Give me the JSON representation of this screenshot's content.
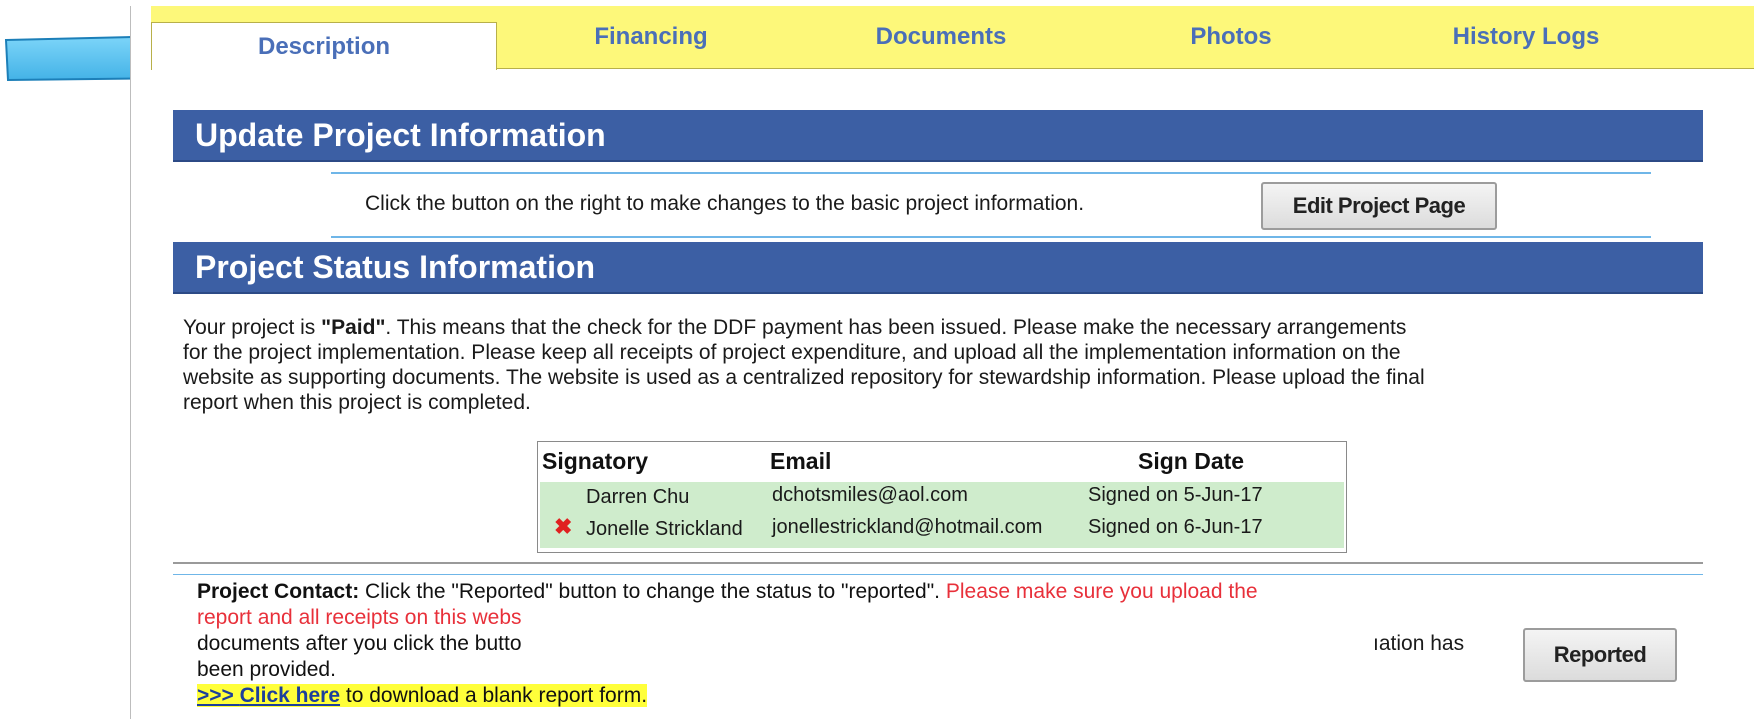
{
  "tabs": [
    "Description",
    "Financing",
    "Documents",
    "Photos",
    "History Logs"
  ],
  "active_tab": "Description",
  "update_section": {
    "title": "Update Project Information",
    "instruction": "Click the button on the right to make changes to the basic project information.",
    "button_label": "Edit Project Page"
  },
  "status_section": {
    "title": "Project Status Information",
    "lines": [
      {
        "prefix": "Your project is ",
        "bold": "\"Paid\"",
        "rest": ".  This means that the check for the DDF payment has been issued. Please make the necessary arrangements"
      },
      {
        "text": "for the project implementation. Please keep all receipts of project expenditure, and upload all the implementation information on the"
      },
      {
        "text": "website as supporting documents. The website is used as a centralized repository for stewardship information. Please upload the final"
      },
      {
        "text": "report when this project is completed."
      }
    ]
  },
  "signatories": {
    "headers": {
      "signatory": "Signatory",
      "email": "Email",
      "sign_date": "Sign Date"
    },
    "rows": [
      {
        "name": "Darren Chu",
        "email": "dchotsmiles@aol.com",
        "date": "Signed on 5-Jun-17",
        "icon": "none"
      },
      {
        "name": "Jonelle Strickland",
        "email": "jonellestrickland@hotmail.com",
        "date": "Signed on 6-Jun-17",
        "icon": "red-x-icon"
      }
    ],
    "x_glyph": "✖"
  },
  "contact": {
    "label": "Project Contact:",
    "line1_text": " Click the \"Reported\" button to change the status to \"reported\".  ",
    "line1_red": "Please make sure you upload the",
    "line2_red": "report and all receipts on this webs",
    "line3_left": "documents after you click the butto",
    "line3_right": "ıation has",
    "line4": "been provided.",
    "link_prefix": ">>> ",
    "link_label": "Click here",
    "link_rest": " to download a blank report form.",
    "button_label": "Reported"
  },
  "colors": {
    "tabbar": "#fdf87a",
    "section_header": "#3c5fa4",
    "tab_text": "#4a6fb8",
    "signatory_rows": "#cfeccc",
    "warning_red": "#e8303a",
    "arrow": "#5cc8f0"
  }
}
